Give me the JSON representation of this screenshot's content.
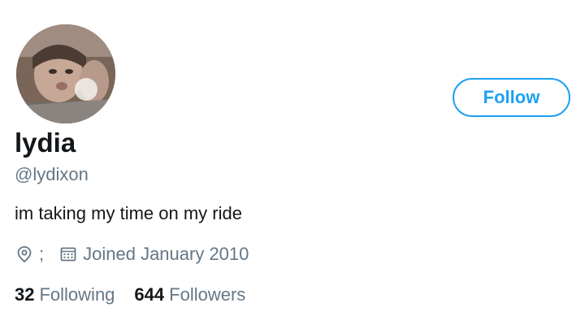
{
  "profile": {
    "display_name": "lydia",
    "handle": "@lydixon",
    "bio": "im taking my time on my ride",
    "location": ";",
    "joined": "Joined January 2010",
    "avatar_alt": "profile photo"
  },
  "actions": {
    "follow_label": "Follow"
  },
  "stats": {
    "following_count": "32",
    "following_label": "Following",
    "followers_count": "644",
    "followers_label": "Followers"
  },
  "icons": {
    "location": "location-pin-icon",
    "joined": "calendar-icon"
  },
  "colors": {
    "accent": "#1da1f2",
    "text_primary": "#14171a",
    "text_secondary": "#657786",
    "background": "#ffffff"
  }
}
